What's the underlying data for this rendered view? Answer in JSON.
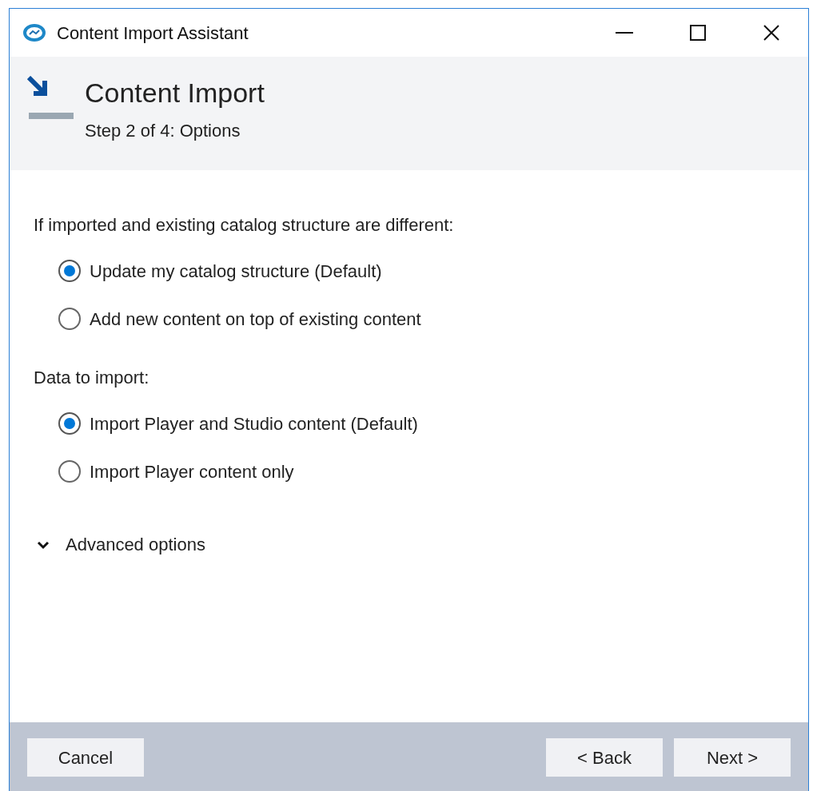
{
  "window": {
    "title": "Content Import Assistant"
  },
  "header": {
    "title": "Content Import",
    "subtitle": "Step 2 of 4: Options"
  },
  "groups": [
    {
      "label": "If imported and existing catalog structure are different:",
      "options": [
        {
          "label": "Update my catalog structure (Default)",
          "selected": true
        },
        {
          "label": "Add new content on top of existing content",
          "selected": false
        }
      ]
    },
    {
      "label": "Data to import:",
      "options": [
        {
          "label": "Import Player and Studio content (Default)",
          "selected": true
        },
        {
          "label": "Import Player content only",
          "selected": false
        }
      ]
    }
  ],
  "advanced": {
    "label": "Advanced options",
    "expanded": false
  },
  "footer": {
    "left": [
      "Cancel"
    ],
    "right": [
      "< Back",
      "Next >"
    ]
  }
}
